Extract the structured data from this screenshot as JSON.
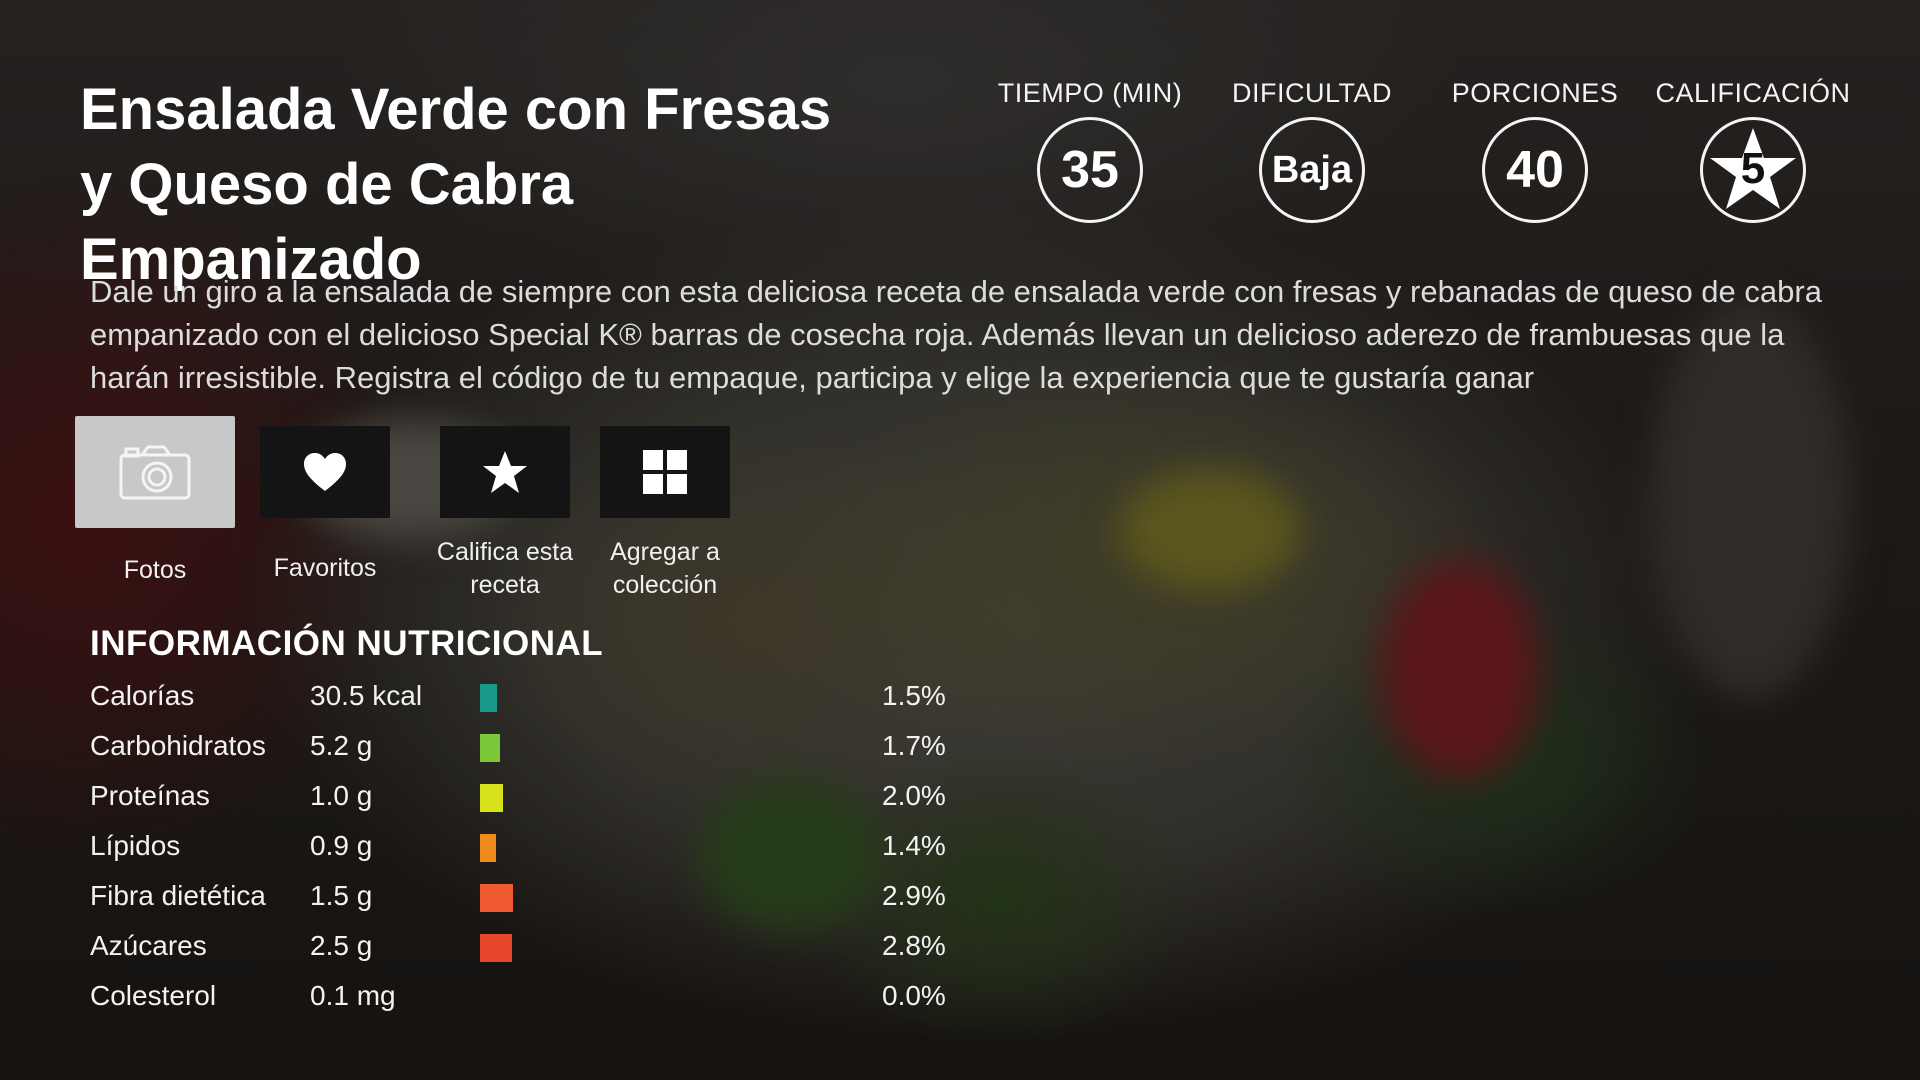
{
  "recipe": {
    "title": "Ensalada Verde con Fresas y Queso de Cabra Empanizado",
    "description": "Dale un giro a la ensalada de siempre con esta deliciosa receta de ensalada verde con fresas y rebanadas de queso de cabra empanizado con el delicioso Special K® barras de cosecha roja. Además llevan un delicioso aderezo de frambuesas que la harán irresistible. Registra el código de tu empaque, participa y elige la experiencia que te gustaría ganar"
  },
  "stats": {
    "time_label": "TIEMPO (MIN)",
    "time_value": "35",
    "difficulty_label": "DIFICULTAD",
    "difficulty_value": "Baja",
    "servings_label": "PORCIONES",
    "servings_value": "40",
    "rating_label": "CALIFICACIÓN",
    "rating_value": "5"
  },
  "actions": [
    {
      "label": "Fotos",
      "icon": "camera-icon",
      "active": true
    },
    {
      "label": "Favoritos",
      "icon": "heart-icon",
      "active": false
    },
    {
      "label": "Califica esta receta",
      "icon": "star-icon",
      "active": false
    },
    {
      "label": "Agregar a colección",
      "icon": "grid-icon",
      "active": false
    }
  ],
  "nutrition": {
    "title": "INFORMACIÓN NUTRICIONAL",
    "rows": [
      {
        "name": "Calorías",
        "amount": "30.5 kcal",
        "percent": "1.5%",
        "value": 1.5,
        "color": "#1a9a8a"
      },
      {
        "name": "Carbohidratos",
        "amount": "5.2 g",
        "percent": "1.7%",
        "value": 1.7,
        "color": "#7cc63a"
      },
      {
        "name": "Proteínas",
        "amount": "1.0 g",
        "percent": "2.0%",
        "value": 2.0,
        "color": "#d8e21c"
      },
      {
        "name": "Lípidos",
        "amount": "0.9 g",
        "percent": "1.4%",
        "value": 1.4,
        "color": "#f08a1c"
      },
      {
        "name": "Fibra dietética",
        "amount": "1.5 g",
        "percent": "2.9%",
        "value": 2.9,
        "color": "#f05a30"
      },
      {
        "name": "Azúcares",
        "amount": "2.5 g",
        "percent": "2.8%",
        "value": 2.8,
        "color": "#e8462a"
      },
      {
        "name": "Colesterol",
        "amount": "0.1 mg",
        "percent": "0.0%",
        "value": 0.0,
        "color": "#e8462a"
      }
    ]
  }
}
